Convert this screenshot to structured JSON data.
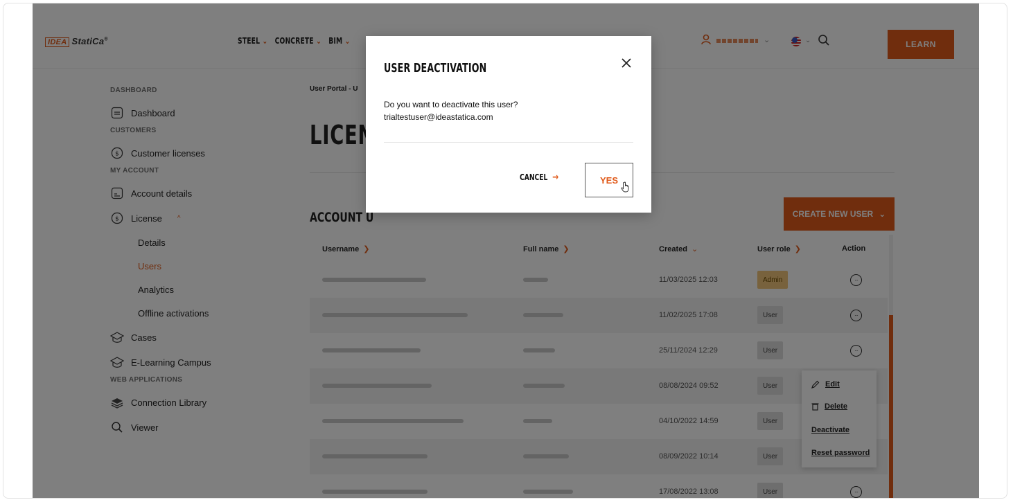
{
  "header": {
    "logo_box": "IDEA",
    "logo_text": "StatiCa",
    "logo_reg": "®",
    "nav": [
      {
        "label": "STEEL"
      },
      {
        "label": "CONCRETE"
      },
      {
        "label": "BIM"
      }
    ],
    "learn_label": "LEARN"
  },
  "sidebar": {
    "sections": {
      "dashboard": "DASHBOARD",
      "customers": "CUSTOMERS",
      "my_account": "MY ACCOUNT",
      "web_applications": "WEB APPLICATIONS"
    },
    "items": {
      "dashboard": "Dashboard",
      "customer_licenses": "Customer licenses",
      "account_details": "Account details",
      "license": "License",
      "details": "Details",
      "users": "Users",
      "analytics": "Analytics",
      "offline_activations": "Offline activations",
      "cases": "Cases",
      "elearning": "E-Learning Campus",
      "connection_library": "Connection Library",
      "viewer": "Viewer"
    }
  },
  "main": {
    "breadcrumb": "User Portal  -  U",
    "title": "LICENS",
    "account_users_title": "ACCOUNT U",
    "create_user_label": "CREATE NEW USER",
    "columns": {
      "username": "Username",
      "full_name": "Full name",
      "created": "Created",
      "user_role": "User role",
      "action": "Action"
    },
    "rows": [
      {
        "created": "11/03/2025 12:03",
        "role": "Admin",
        "alt": false
      },
      {
        "created": "11/02/2025 17:08",
        "role": "User",
        "alt": true
      },
      {
        "created": "25/11/2024 12:29",
        "role": "User",
        "alt": false
      },
      {
        "created": "08/08/2024 09:52",
        "role": "User",
        "alt": true
      },
      {
        "created": "04/10/2022 14:59",
        "role": "User",
        "alt": false
      },
      {
        "created": "08/09/2022 10:14",
        "role": "User",
        "alt": true
      },
      {
        "created": "17/08/2022 13:08",
        "role": "User",
        "alt": false
      }
    ],
    "context_menu": {
      "edit": "Edit",
      "delete": "Delete",
      "deactivate": "Deactivate",
      "reset_password": "Reset password"
    }
  },
  "modal": {
    "title": "USER DEACTIVATION",
    "question": "Do you want to deactivate this user?",
    "email": "trialtestuser@ideastatica.com",
    "cancel_label": "CANCEL",
    "yes_label": "YES"
  },
  "colors": {
    "accent": "#e05a1a",
    "admin_badge": "#f1c57b",
    "user_badge": "#dcdcdc"
  }
}
